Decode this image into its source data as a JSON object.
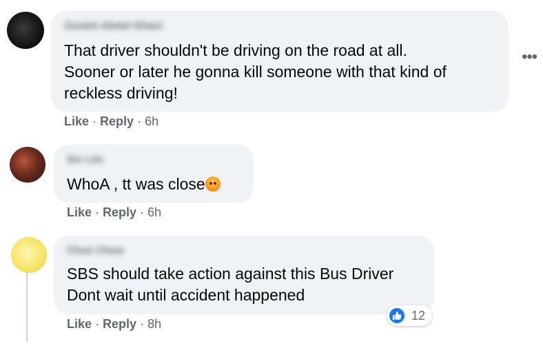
{
  "comments": [
    {
      "author": "Zuraini Abdul Ghani",
      "lines": [
        "That driver shouldn't be driving on the road at all.",
        "Sooner or later he gonna kill someone with that kind of",
        "reckless driving!"
      ],
      "like_label": "Like",
      "reply_label": "Reply",
      "time": "6h"
    },
    {
      "author": "Siv Lim",
      "lines": [
        "WhoA , tt was close"
      ],
      "emoji": "angry-face-emoji",
      "like_label": "Like",
      "reply_label": "Reply",
      "time": "6h"
    },
    {
      "author": "Chun Chew",
      "lines": [
        "SBS should take action against this Bus Driver",
        "Dont wait until accident happened"
      ],
      "like_label": "Like",
      "reply_label": "Reply",
      "time": "8h",
      "reaction_count": "12",
      "reaction_icon": "thumbs-up-icon"
    }
  ],
  "separator": "·",
  "more_icon": "more-options-icon",
  "more_glyph": "•••",
  "colors": {
    "bubble": "#f0f2f5",
    "secondary_text": "#65676b",
    "like_blue": "#1877f2"
  }
}
